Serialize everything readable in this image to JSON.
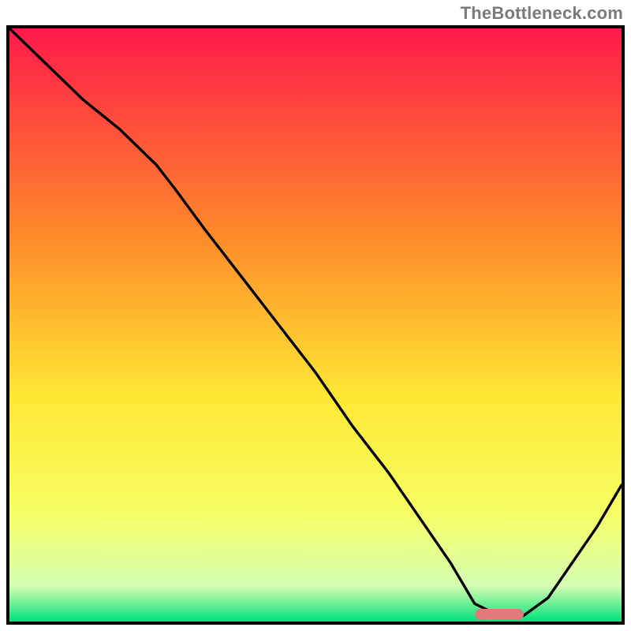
{
  "watermark": "TheBottleneck.com",
  "colors": {
    "frame": "#000000",
    "curve": "#000000",
    "marker": "#e2797b",
    "gradient_top": "#ff1a4a",
    "gradient_mid1": "#ff8a2a",
    "gradient_mid2": "#ffe733",
    "gradient_mid3": "#f6ff66",
    "gradient_mid4": "#d6ffb3",
    "gradient_bottom": "#00e07a"
  },
  "chart_data": {
    "type": "line",
    "title": "",
    "xlabel": "",
    "ylabel": "",
    "xlim": [
      0,
      100
    ],
    "ylim": [
      0,
      100
    ],
    "grid": false,
    "legend": false,
    "annotations": [],
    "series": [
      {
        "name": "bottleneck-curve",
        "x": [
          0,
          6,
          12,
          18,
          24,
          27,
          32,
          38,
          44,
          50,
          56,
          62,
          68,
          72,
          76,
          80,
          84,
          88,
          92,
          96,
          100
        ],
        "values": [
          100,
          94,
          88,
          83,
          77,
          73,
          66,
          58,
          50,
          42,
          33,
          25,
          16,
          10,
          3,
          1,
          1,
          4,
          10,
          16,
          23
        ]
      }
    ],
    "marker": {
      "x_start": 76,
      "x_end": 84,
      "y": 1.2
    }
  }
}
